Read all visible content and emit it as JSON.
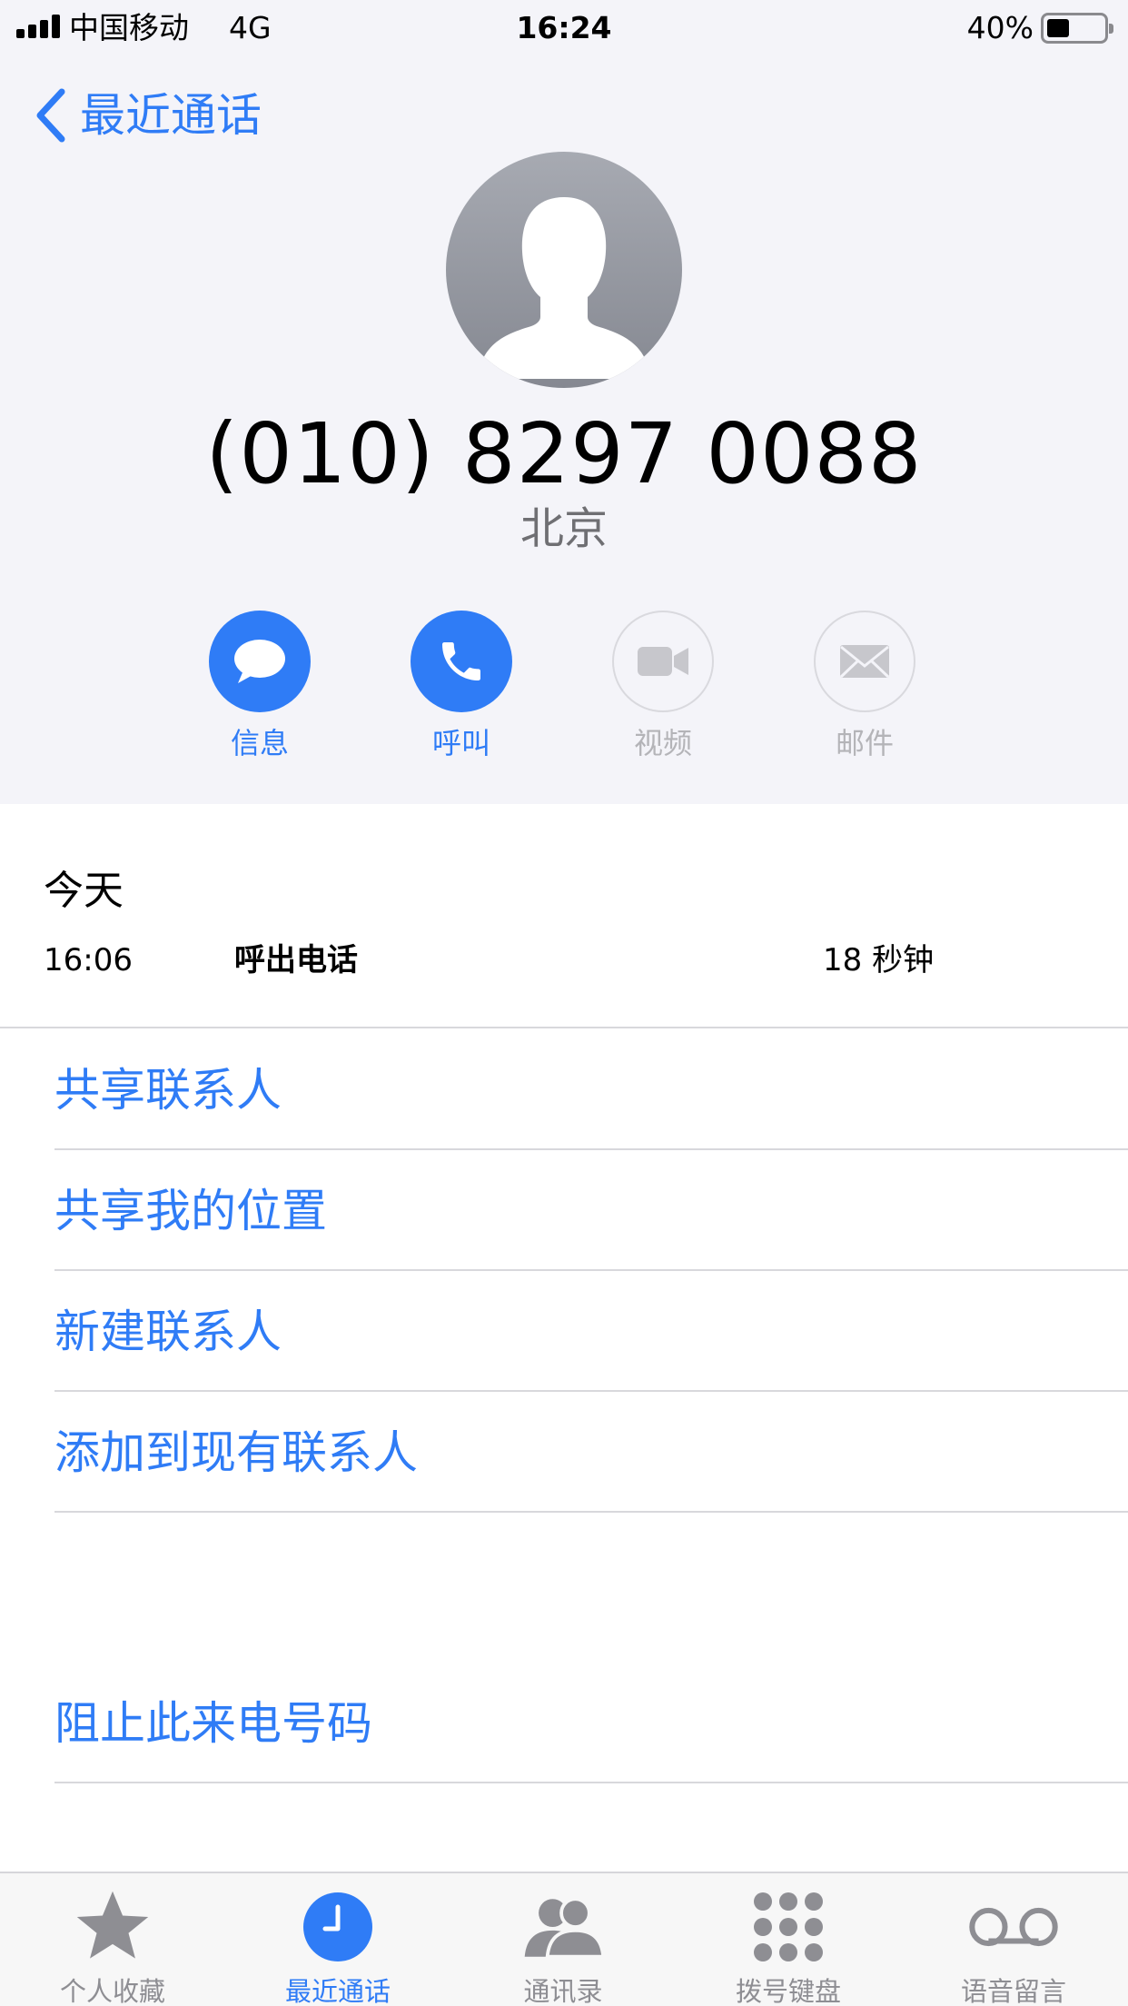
{
  "status_bar": {
    "carrier": "中国移动",
    "network": "4G",
    "time": "16:24",
    "battery_percent": "40%",
    "battery_level": 0.4
  },
  "nav": {
    "back_label": "最近通话"
  },
  "contact": {
    "phone_number": "(010) 8297 0088",
    "location": "北京"
  },
  "actions": [
    {
      "label": "信息",
      "icon": "message-bubble-icon",
      "enabled": true
    },
    {
      "label": "呼叫",
      "icon": "phone-icon",
      "enabled": true
    },
    {
      "label": "视频",
      "icon": "video-camera-icon",
      "enabled": false
    },
    {
      "label": "邮件",
      "icon": "envelope-icon",
      "enabled": false
    }
  ],
  "recent_call": {
    "day": "今天",
    "time": "16:06",
    "type": "呼出电话",
    "duration": "18 秒钟"
  },
  "options": [
    "共享联系人",
    "共享我的位置",
    "新建联系人",
    "添加到现有联系人"
  ],
  "block_option": "阻止此来电号码",
  "tabbar": [
    {
      "label": "个人收藏",
      "icon": "star-icon",
      "active": false
    },
    {
      "label": "最近通话",
      "icon": "clock-icon",
      "active": true
    },
    {
      "label": "通讯录",
      "icon": "contacts-icon",
      "active": false
    },
    {
      "label": "拨号键盘",
      "icon": "keypad-icon",
      "active": false
    },
    {
      "label": "语音留言",
      "icon": "voicemail-icon",
      "active": false
    }
  ],
  "colors": {
    "accent": "#2f7cf6",
    "header_bg": "#f4f4f9",
    "secondary_text": "#6f6f73",
    "disabled": "#b4b4b8"
  }
}
